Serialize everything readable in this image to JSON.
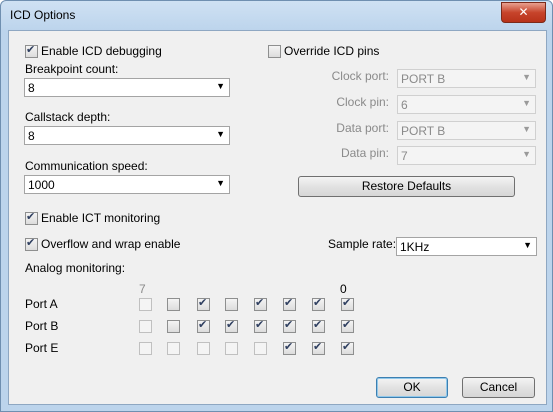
{
  "window": {
    "title": "ICD Options",
    "close_label": "✕"
  },
  "left": {
    "enable_icd_debugging": {
      "label": "Enable ICD debugging",
      "checked": true
    },
    "breakpoint_count": {
      "label": "Breakpoint count:",
      "value": "8"
    },
    "callstack_depth": {
      "label": "Callstack depth:",
      "value": "8"
    },
    "communication_speed": {
      "label": "Communication speed:",
      "value": "1000"
    },
    "enable_ict_monitoring": {
      "label": "Enable ICT monitoring",
      "checked": true
    },
    "overflow_wrap": {
      "label": "Overflow and wrap enable",
      "checked": true
    },
    "analog_monitoring": {
      "label": "Analog monitoring:"
    }
  },
  "right": {
    "override_icd_pins": {
      "label": "Override ICD pins",
      "checked": false
    },
    "clock_port": {
      "label": "Clock port:",
      "value": "PORT B"
    },
    "clock_pin": {
      "label": "Clock pin:",
      "value": "6"
    },
    "data_port": {
      "label": "Data port:",
      "value": "PORT B"
    },
    "data_pin": {
      "label": "Data pin:",
      "value": "7"
    },
    "restore_defaults": "Restore Defaults",
    "sample_rate": {
      "label": "Sample rate:",
      "value": "1KHz"
    }
  },
  "grid": {
    "bit_high": "7",
    "bit_low": "0",
    "rows": [
      {
        "name": "Port A",
        "bits": [
          {
            "checked": false,
            "enabled": false
          },
          {
            "checked": false,
            "enabled": true
          },
          {
            "checked": true,
            "enabled": true
          },
          {
            "checked": false,
            "enabled": true
          },
          {
            "checked": true,
            "enabled": true
          },
          {
            "checked": true,
            "enabled": true
          },
          {
            "checked": true,
            "enabled": true
          },
          {
            "checked": true,
            "enabled": true
          }
        ]
      },
      {
        "name": "Port B",
        "bits": [
          {
            "checked": false,
            "enabled": false
          },
          {
            "checked": false,
            "enabled": true
          },
          {
            "checked": true,
            "enabled": true
          },
          {
            "checked": true,
            "enabled": true
          },
          {
            "checked": true,
            "enabled": true
          },
          {
            "checked": true,
            "enabled": true
          },
          {
            "checked": true,
            "enabled": true
          },
          {
            "checked": true,
            "enabled": true
          }
        ]
      },
      {
        "name": "Port E",
        "bits": [
          {
            "checked": false,
            "enabled": false
          },
          {
            "checked": false,
            "enabled": false
          },
          {
            "checked": false,
            "enabled": false
          },
          {
            "checked": false,
            "enabled": false
          },
          {
            "checked": false,
            "enabled": false
          },
          {
            "checked": true,
            "enabled": true
          },
          {
            "checked": true,
            "enabled": true
          },
          {
            "checked": true,
            "enabled": true
          }
        ]
      }
    ]
  },
  "footer": {
    "ok": "OK",
    "cancel": "Cancel"
  }
}
